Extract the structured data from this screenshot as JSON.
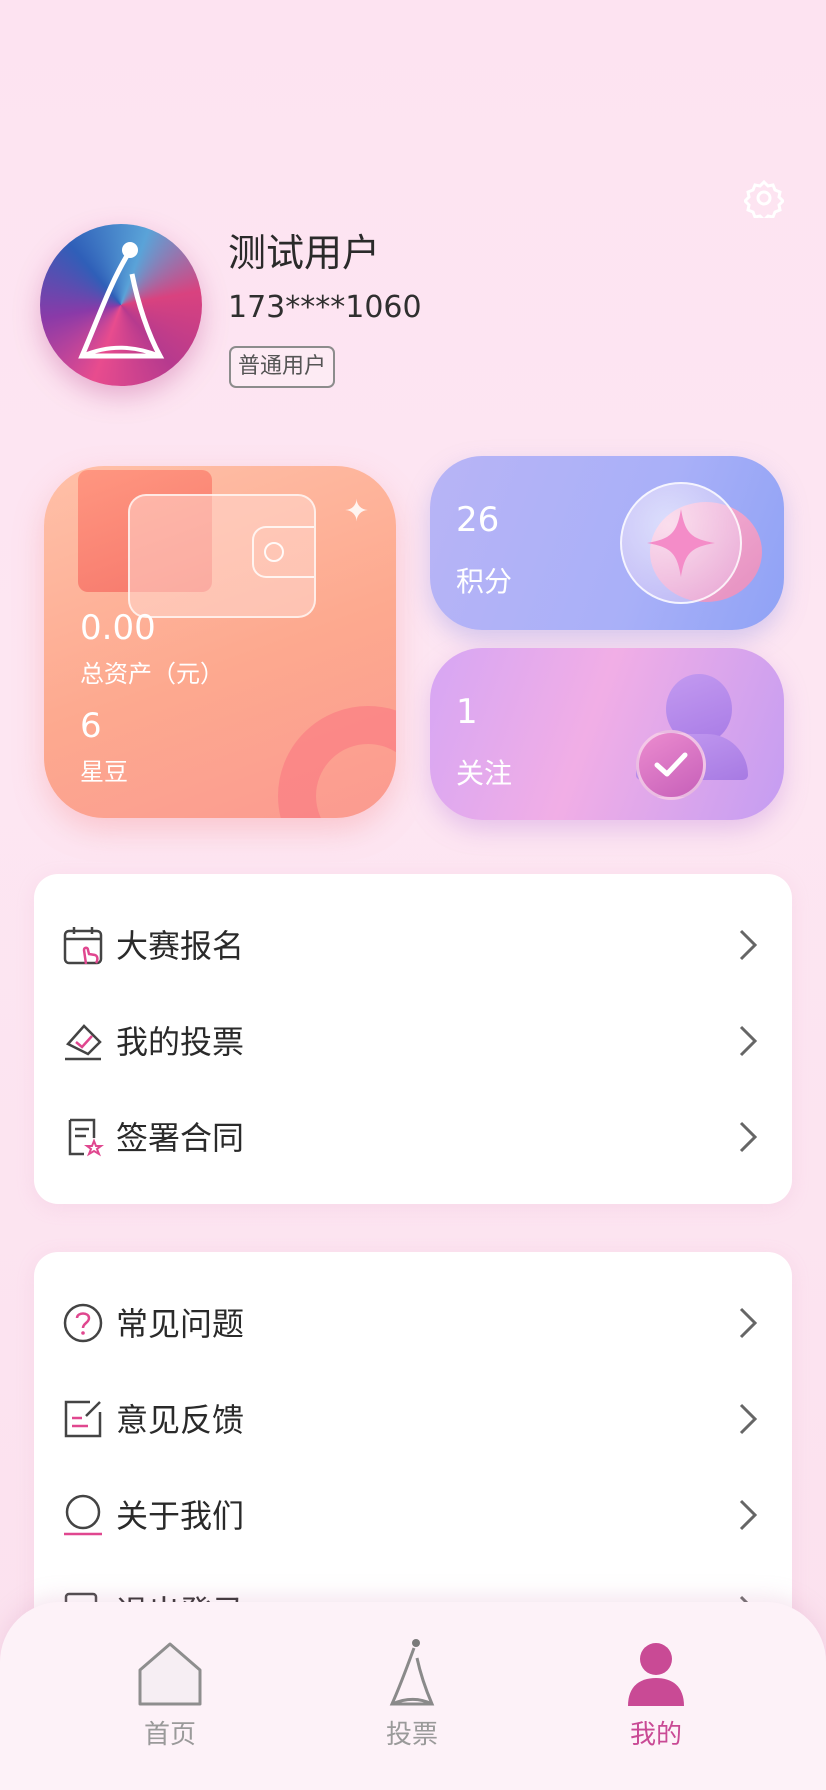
{
  "profile": {
    "name": "测试用户",
    "phone": "173****1060",
    "role": "普通用户"
  },
  "stats": {
    "assets_value": "0.00",
    "assets_label": "总资产（元）",
    "beans_value": "6",
    "beans_label": "星豆",
    "points_value": "26",
    "points_label": "积分",
    "follow_value": "1",
    "follow_label": "关注"
  },
  "menu_group_1": [
    {
      "label": "大赛报名",
      "icon": "calendar-hand-icon"
    },
    {
      "label": "我的投票",
      "icon": "vote-check-icon"
    },
    {
      "label": "签署合同",
      "icon": "contract-star-icon"
    }
  ],
  "menu_group_2": [
    {
      "label": "常见问题",
      "icon": "question-icon"
    },
    {
      "label": "意见反馈",
      "icon": "feedback-icon"
    },
    {
      "label": "关于我们",
      "icon": "about-circle-icon"
    },
    {
      "label": "退出登录",
      "icon": "logout-icon"
    }
  ],
  "tabs": [
    {
      "label": "首页",
      "icon": "home-icon"
    },
    {
      "label": "投票",
      "icon": "vote-figure-icon"
    },
    {
      "label": "我的",
      "icon": "user-icon"
    }
  ],
  "colors": {
    "accent": "#c94a95",
    "tab_inactive": "#9a9a9a",
    "icon_accent": "#e0478f"
  }
}
